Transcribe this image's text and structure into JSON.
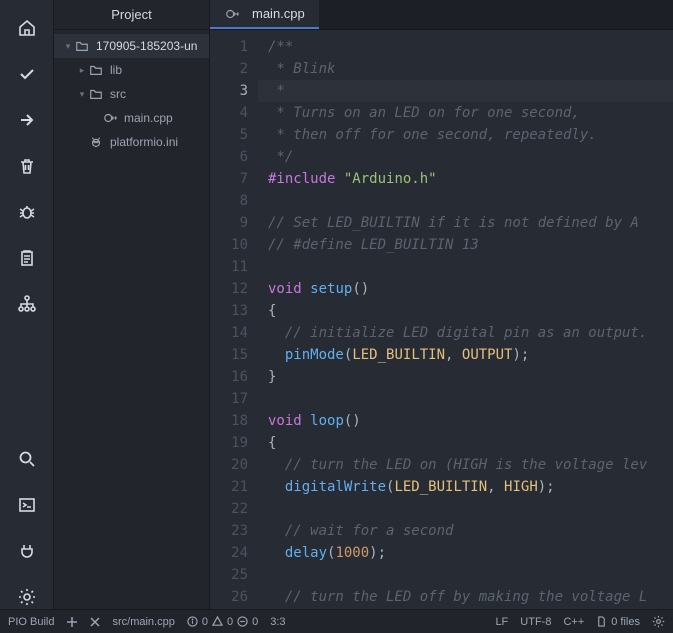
{
  "activity_icons": [
    "home",
    "check",
    "arrow-right",
    "trash",
    "bug",
    "clipboard",
    "hierarchy",
    "search",
    "terminal",
    "plug",
    "gear"
  ],
  "side_header": "Project",
  "tree": [
    {
      "depth": 0,
      "tw": "▾",
      "icon": "folder",
      "label": "170905-185203-un",
      "sel": true
    },
    {
      "depth": 1,
      "tw": "▸",
      "icon": "folder",
      "label": "lib"
    },
    {
      "depth": 1,
      "tw": "▾",
      "icon": "folder",
      "label": "src"
    },
    {
      "depth": 2,
      "tw": "",
      "icon": "cpp",
      "label": "main.cpp"
    },
    {
      "depth": 1,
      "tw": "",
      "icon": "pio",
      "label": "platformio.ini"
    }
  ],
  "tab": {
    "icon": "cpp",
    "label": "main.cpp"
  },
  "current_line": 3,
  "code": [
    [
      [
        "comment",
        "/**"
      ]
    ],
    [
      [
        "comment",
        " * Blink"
      ]
    ],
    [
      [
        "comment",
        " *"
      ]
    ],
    [
      [
        "comment",
        " * Turns on an LED on for one second,"
      ]
    ],
    [
      [
        "comment",
        " * then off for one second, repeatedly."
      ]
    ],
    [
      [
        "comment",
        " */"
      ]
    ],
    [
      [
        "keyword",
        "#include"
      ],
      [
        "punc",
        " "
      ],
      [
        "string",
        "\"Arduino.h\""
      ]
    ],
    [],
    [
      [
        "comment",
        "// Set LED_BUILTIN if it is not defined by A"
      ]
    ],
    [
      [
        "comment",
        "// #define LED_BUILTIN 13"
      ]
    ],
    [],
    [
      [
        "keyword",
        "void"
      ],
      [
        "punc",
        " "
      ],
      [
        "func",
        "setup"
      ],
      [
        "punc",
        "()"
      ]
    ],
    [
      [
        "punc",
        "{"
      ]
    ],
    [
      [
        "punc",
        "  "
      ],
      [
        "comment",
        "// initialize LED digital pin as an output."
      ]
    ],
    [
      [
        "punc",
        "  "
      ],
      [
        "func",
        "pinMode"
      ],
      [
        "punc",
        "("
      ],
      [
        "ident",
        "LED_BUILTIN"
      ],
      [
        "punc",
        ", "
      ],
      [
        "ident",
        "OUTPUT"
      ],
      [
        "punc",
        ");"
      ]
    ],
    [
      [
        "punc",
        "}"
      ]
    ],
    [],
    [
      [
        "keyword",
        "void"
      ],
      [
        "punc",
        " "
      ],
      [
        "func",
        "loop"
      ],
      [
        "punc",
        "()"
      ]
    ],
    [
      [
        "punc",
        "{"
      ]
    ],
    [
      [
        "punc",
        "  "
      ],
      [
        "comment",
        "// turn the LED on (HIGH is the voltage lev"
      ]
    ],
    [
      [
        "punc",
        "  "
      ],
      [
        "func",
        "digitalWrite"
      ],
      [
        "punc",
        "("
      ],
      [
        "ident",
        "LED_BUILTIN"
      ],
      [
        "punc",
        ", "
      ],
      [
        "ident",
        "HIGH"
      ],
      [
        "punc",
        ");"
      ]
    ],
    [],
    [
      [
        "punc",
        "  "
      ],
      [
        "comment",
        "// wait for a second"
      ]
    ],
    [
      [
        "punc",
        "  "
      ],
      [
        "func",
        "delay"
      ],
      [
        "punc",
        "("
      ],
      [
        "num",
        "1000"
      ],
      [
        "punc",
        ");"
      ]
    ],
    [],
    [
      [
        "punc",
        "  "
      ],
      [
        "comment",
        "// turn the LED off by making the voltage L"
      ]
    ]
  ],
  "status": {
    "build": "PIO Build",
    "path": "src/main.cpp",
    "diag_info": "0",
    "diag_warn": "0",
    "diag_err": "0",
    "cursor": "3:3",
    "eol": "LF",
    "encoding": "UTF-8",
    "lang": "C++",
    "files": "0 files"
  }
}
